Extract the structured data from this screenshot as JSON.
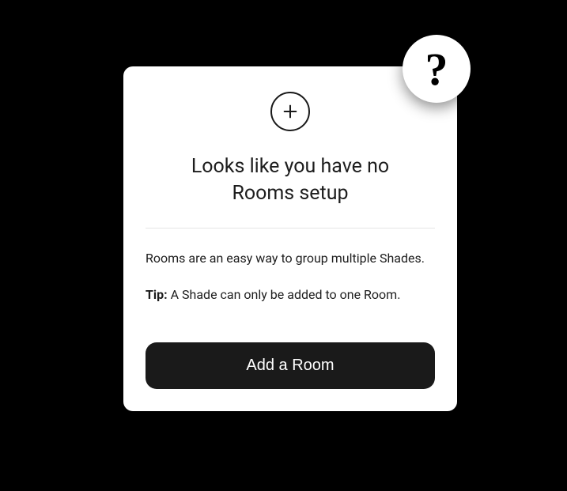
{
  "card": {
    "icon": "plus-icon",
    "title": "Looks like you have no Rooms setup",
    "description": "Rooms are an easy way to group multiple Shades.",
    "tip_label": "Tip:",
    "tip_text": " A Shade can only be added to one Room.",
    "button_label": "Add a Room"
  },
  "help": {
    "label": "?"
  }
}
